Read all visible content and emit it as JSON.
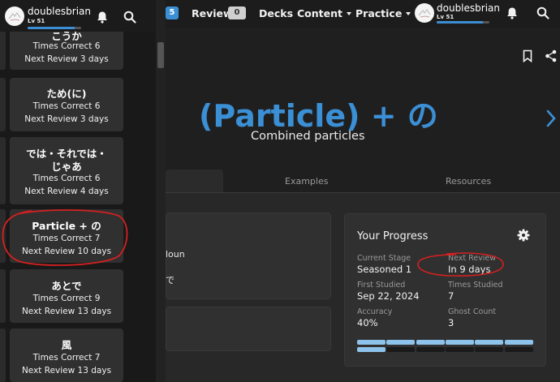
{
  "topbar": {
    "badge_count": "5",
    "review_label": "Review",
    "review_count": "0",
    "decks_label": "Decks",
    "content_label": "Content",
    "practice_label": "Practice"
  },
  "user": {
    "name": "doublesbrian",
    "level": "Lv 51"
  },
  "grammar": {
    "title": "(Particle) + の",
    "subtitle": "Combined particles"
  },
  "tabs": [
    {
      "label": "Examples"
    },
    {
      "label": "Resources"
    }
  ],
  "fragments": {
    "noun": "loun",
    "de": "で"
  },
  "progress": {
    "title": "Your Progress",
    "current_stage_label": "Current Stage",
    "current_stage": "Seasoned 1",
    "next_review_label": "Next Review",
    "next_review": "In 9 days",
    "first_studied_label": "First Studied",
    "first_studied": "Sep 22, 2024",
    "times_studied_label": "Times Studied",
    "times_studied": "7",
    "accuracy_label": "Accuracy",
    "accuracy": "40%",
    "ghost_count_label": "Ghost Count",
    "ghost_count": "3",
    "segments_filled": 7,
    "segments_total": 12
  },
  "sidebar": {
    "cards": [
      {
        "title": "こうか",
        "correct": "Times Correct 6",
        "next": "Next Review 3 days"
      },
      {
        "title": "ため(に)",
        "correct": "Times Correct 6",
        "next": "Next Review 3 days"
      },
      {
        "title_line1": "では・それでは・",
        "title_line2": "じゃあ",
        "correct": "Times Correct 6",
        "next": "Next Review 4 days"
      },
      {
        "title": "Particle + の",
        "correct": "Times Correct 7",
        "next": "Next Review 10 days"
      },
      {
        "title": "あとで",
        "correct": "Times Correct 9",
        "next": "Next Review 13 days"
      },
      {
        "title": "風",
        "correct": "Times Correct 7",
        "next": "Next Review 13 days"
      }
    ]
  },
  "colors": {
    "accent": "#3b8fd4",
    "annotation": "#d62020",
    "segment_filled": "#8ec3ec"
  }
}
